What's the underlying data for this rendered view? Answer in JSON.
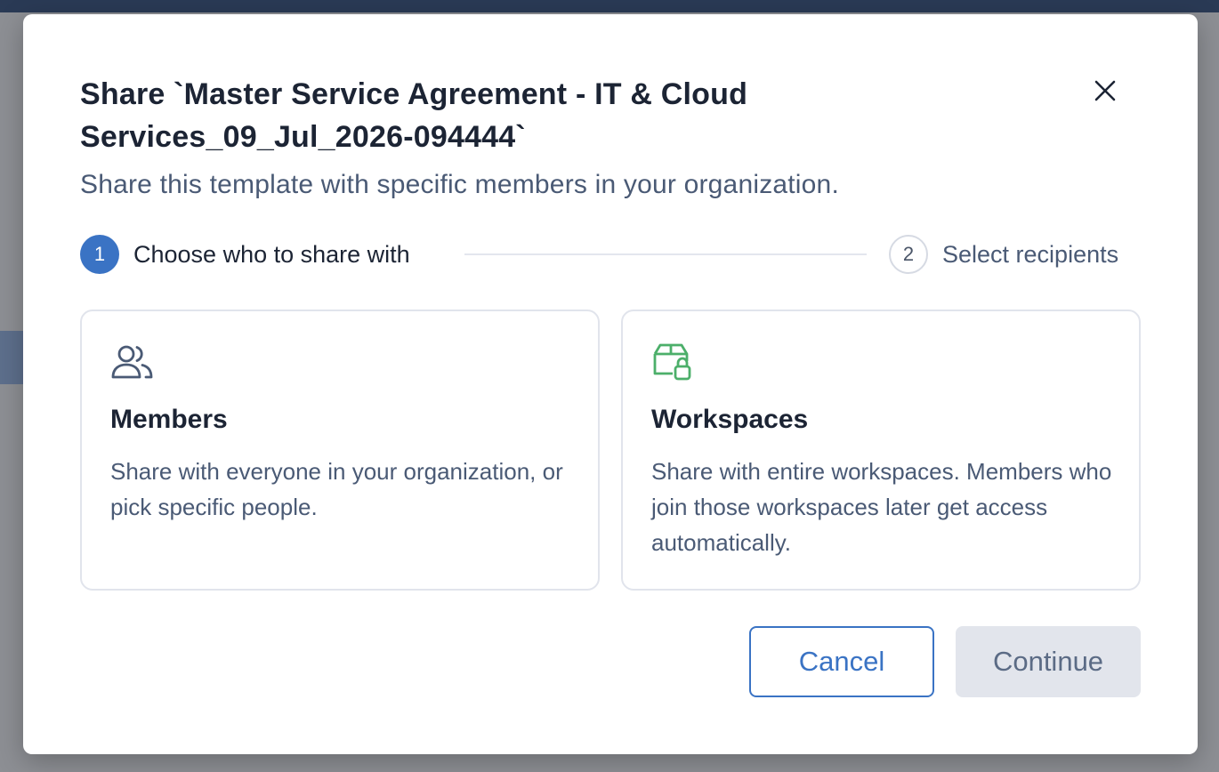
{
  "dialog": {
    "title": "Share `Master Service Agreement - IT & Cloud Services_09_Jul_2026-094444`",
    "subtitle": "Share this template with specific members in your organization.",
    "close_icon": "close-icon"
  },
  "stepper": {
    "steps": [
      {
        "number": "1",
        "label": "Choose who to share with",
        "active": true
      },
      {
        "number": "2",
        "label": "Select recipients",
        "active": false
      }
    ]
  },
  "options": [
    {
      "icon": "users-icon",
      "title": "Members",
      "description": "Share with everyone in your organization, or pick specific people."
    },
    {
      "icon": "workspace-lock-icon",
      "title": "Workspaces",
      "description": "Share with entire workspaces. Members who join those workspaces later get access automatically."
    }
  ],
  "actions": {
    "cancel_label": "Cancel",
    "continue_label": "Continue"
  },
  "colors": {
    "accent": "#3a73c4",
    "workspace_icon": "#4caf6a",
    "text_primary": "#1c2434",
    "text_secondary": "#4a5a75"
  }
}
